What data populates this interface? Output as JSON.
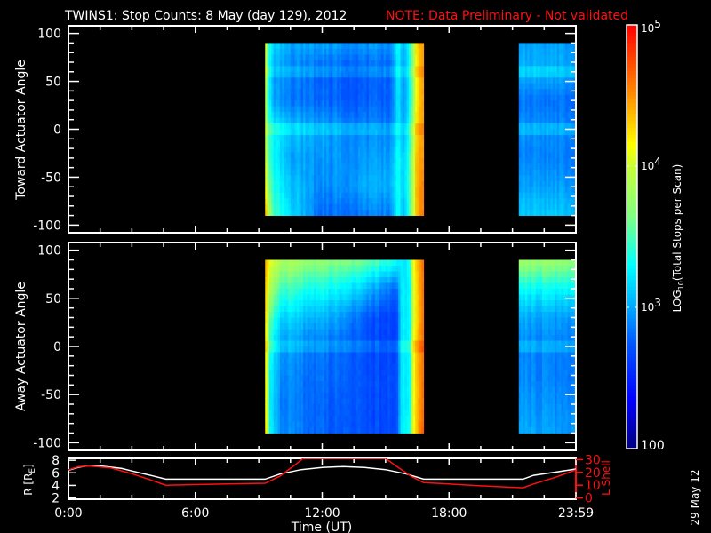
{
  "title": {
    "main": "TWINS1: Stop Counts:  8 May (day 129), 2012",
    "note": "NOTE: Data Preliminary - Not validated"
  },
  "stamp": "29 May 12",
  "chart_data": [
    {
      "type": "heatmap",
      "name": "toward",
      "ylabel": "Toward Actuator Angle",
      "ylim": [
        -108,
        108
      ],
      "yticks": [
        "100",
        "50",
        "0",
        "-50",
        "-100"
      ],
      "ytick_values": [
        100,
        50,
        0,
        -50,
        -100
      ],
      "xlim": [
        0,
        24
      ],
      "angle_grid": [
        90,
        60,
        30,
        0,
        -30,
        -60,
        -90
      ],
      "ridges": [
        60,
        0
      ],
      "blocks": [
        {
          "t0": 9.3,
          "t1": 16.8,
          "keys": [
            {
              "t": 9.3,
              "v": [
                4.3,
                4.2,
                4.1,
                4.1,
                4.2,
                4.3,
                4.5
              ]
            },
            {
              "t": 9.45,
              "v": [
                3.5,
                3.4,
                3.4,
                3.5,
                3.6,
                3.7,
                4.0
              ]
            },
            {
              "t": 9.7,
              "v": [
                3.2,
                3.0,
                3.0,
                3.3,
                3.3,
                3.4,
                3.5
              ]
            },
            {
              "t": 10.5,
              "v": [
                3.0,
                2.9,
                2.85,
                3.1,
                3.0,
                3.1,
                3.2
              ]
            },
            {
              "t": 12.0,
              "v": [
                3.0,
                2.8,
                2.8,
                3.0,
                2.95,
                2.9,
                2.8
              ]
            },
            {
              "t": 14.0,
              "v": [
                2.95,
                2.75,
                2.75,
                2.9,
                2.95,
                3.0,
                2.85
              ]
            },
            {
              "t": 15.3,
              "v": [
                2.95,
                2.8,
                2.8,
                2.9,
                3.0,
                3.05,
                2.9
              ]
            },
            {
              "t": 15.6,
              "v": [
                3.3,
                3.2,
                3.2,
                3.2,
                3.3,
                3.3,
                3.3
              ]
            },
            {
              "t": 15.9,
              "v": [
                3.0,
                2.9,
                2.9,
                2.95,
                3.1,
                3.1,
                3.0
              ]
            },
            {
              "t": 16.2,
              "v": [
                3.5,
                3.4,
                3.4,
                3.5,
                3.6,
                3.6,
                3.6
              ]
            },
            {
              "t": 16.45,
              "v": [
                4.2,
                4.1,
                4.1,
                4.2,
                4.3,
                4.3,
                4.3
              ]
            },
            {
              "t": 16.8,
              "v": [
                4.5,
                4.5,
                4.5,
                4.5,
                4.5,
                4.6,
                4.6
              ]
            }
          ]
        },
        {
          "t0": 21.3,
          "t1": 24,
          "keys": [
            {
              "t": 21.3,
              "v": [
                3.0,
                3.05,
                2.85,
                2.95,
                2.9,
                3.0,
                3.15
              ]
            },
            {
              "t": 24,
              "v": [
                2.95,
                3.0,
                2.8,
                2.9,
                2.85,
                2.95,
                3.1
              ]
            }
          ]
        }
      ]
    },
    {
      "type": "heatmap",
      "name": "away",
      "ylabel": "Away Actuator Angle",
      "ylim": [
        -108,
        108
      ],
      "yticks": [
        "100",
        "50",
        "0",
        "-50",
        "-100"
      ],
      "ytick_values": [
        100,
        50,
        0,
        -50,
        -100
      ],
      "xlim": [
        0,
        24
      ],
      "angle_grid": [
        90,
        60,
        30,
        0,
        -30,
        -60,
        -90
      ],
      "ridges": [
        0
      ],
      "blocks": [
        {
          "t0": 9.3,
          "t1": 16.8,
          "keys": [
            {
              "t": 9.3,
              "v": [
                4.5,
                4.4,
                4.4,
                4.4,
                4.4,
                4.4,
                4.5
              ]
            },
            {
              "t": 9.5,
              "v": [
                4.1,
                3.9,
                3.6,
                3.4,
                3.3,
                3.3,
                3.3
              ]
            },
            {
              "t": 10.0,
              "v": [
                3.9,
                3.5,
                3.2,
                3.0,
                2.95,
                2.9,
                2.95
              ]
            },
            {
              "t": 11.0,
              "v": [
                3.8,
                3.4,
                3.1,
                2.9,
                2.85,
                2.85,
                2.85
              ]
            },
            {
              "t": 12.5,
              "v": [
                3.7,
                3.3,
                3.0,
                2.8,
                2.8,
                2.75,
                2.75
              ]
            },
            {
              "t": 14.0,
              "v": [
                3.6,
                3.1,
                2.75,
                2.7,
                2.7,
                2.7,
                2.7
              ]
            },
            {
              "t": 15.5,
              "v": [
                3.4,
                2.8,
                2.65,
                2.65,
                2.7,
                2.7,
                2.7
              ]
            },
            {
              "t": 15.8,
              "v": [
                3.2,
                3.3,
                3.3,
                3.3,
                3.3,
                3.3,
                3.3
              ]
            },
            {
              "t": 16.1,
              "v": [
                3.3,
                3.2,
                3.2,
                3.2,
                3.2,
                3.2,
                3.3
              ]
            },
            {
              "t": 16.4,
              "v": [
                4.3,
                4.2,
                4.2,
                4.3,
                4.3,
                4.3,
                4.3
              ]
            },
            {
              "t": 16.8,
              "v": [
                4.6,
                4.6,
                4.6,
                4.6,
                4.6,
                4.6,
                4.7
              ]
            }
          ]
        },
        {
          "t0": 21.3,
          "t1": 24,
          "keys": [
            {
              "t": 21.3,
              "v": [
                3.8,
                3.3,
                3.0,
                2.9,
                2.9,
                2.95,
                3.0
              ]
            },
            {
              "t": 24,
              "v": [
                3.75,
                3.3,
                2.95,
                2.85,
                2.85,
                2.9,
                2.95
              ]
            }
          ]
        }
      ]
    },
    {
      "type": "line",
      "name": "orbit",
      "xlabel": "Time (UT)",
      "xticks": [
        "0:00",
        "6:00",
        "12:00",
        "18:00",
        "23:59"
      ],
      "xtick_values": [
        0,
        6,
        12,
        18,
        24
      ],
      "xlim": [
        0,
        24
      ],
      "ylabel_left": "R [R",
      "ylabel_left_sub": "E",
      "ylabel_left_end": "]",
      "ylim_left": [
        1.8,
        8.3
      ],
      "yticks_left": [
        "8",
        "6",
        "4",
        "2"
      ],
      "ytick_values_left": [
        8,
        6,
        4,
        2
      ],
      "ylabel_right": "L Shell",
      "ylim_right": [
        -1,
        31
      ],
      "yticks_right": [
        "30",
        "20",
        "10",
        "0"
      ],
      "ytick_values_right": [
        30,
        20,
        10,
        0
      ],
      "series": [
        {
          "name": "R",
          "axis": "left",
          "color": "#ffffff",
          "x": [
            0,
            0.5,
            1,
            1.5,
            2,
            2.5,
            3,
            3.5,
            4,
            4.6,
            9.3,
            10,
            11,
            12,
            13,
            14,
            15,
            16,
            16.8,
            21.5,
            22,
            23,
            24
          ],
          "y": [
            6.4,
            6.9,
            7.15,
            7.1,
            6.9,
            6.7,
            6.3,
            5.9,
            5.5,
            5.0,
            5.0,
            5.8,
            6.5,
            6.85,
            7.0,
            6.85,
            6.5,
            5.8,
            5.0,
            5.0,
            5.6,
            6.1,
            6.6
          ]
        },
        {
          "name": "L Shell",
          "axis": "right",
          "color": "#ff1010",
          "x": [
            0,
            0.5,
            1,
            2,
            3,
            4,
            4.6,
            5.5,
            7.5,
            9.3,
            10,
            10.8,
            11.1,
            15.0,
            15.5,
            16.2,
            16.8,
            18,
            19.5,
            21.5,
            22,
            23,
            24
          ],
          "y": [
            22,
            24.5,
            25,
            23.5,
            19,
            13.5,
            10,
            10.3,
            11,
            11.5,
            17,
            27,
            31,
            31,
            25,
            17,
            12,
            11,
            9.5,
            8,
            11,
            16,
            22
          ]
        }
      ]
    }
  ],
  "colorbar": {
    "title_main": "LOG",
    "title_sub": "10",
    "title_rest": "(Total Stops per Scan)",
    "range_log": [
      2,
      5
    ],
    "labels": [
      {
        "base": "10",
        "exp": "5",
        "log": 5
      },
      {
        "base": "10",
        "exp": "4",
        "log": 4
      },
      {
        "base": "10",
        "exp": "3",
        "log": 3
      }
    ],
    "bottom_label": "100",
    "stops": [
      {
        "v": 2.0,
        "c": "#00007f"
      },
      {
        "v": 2.35,
        "c": "#0000ff"
      },
      {
        "v": 2.75,
        "c": "#0058ff"
      },
      {
        "v": 3.0,
        "c": "#00a8ff"
      },
      {
        "v": 3.3,
        "c": "#00ffff"
      },
      {
        "v": 3.65,
        "c": "#80ff80"
      },
      {
        "v": 4.0,
        "c": "#c8ff38"
      },
      {
        "v": 4.15,
        "c": "#ffff00"
      },
      {
        "v": 4.5,
        "c": "#ff9000"
      },
      {
        "v": 5.0,
        "c": "#ff0000"
      }
    ]
  }
}
